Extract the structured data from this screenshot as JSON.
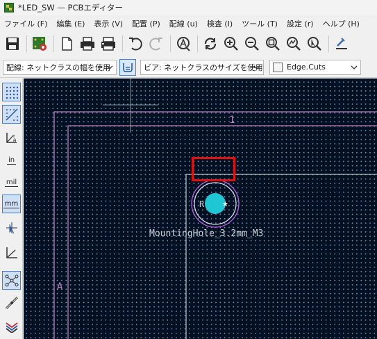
{
  "window": {
    "title": "*LED_SW — PCBエディター"
  },
  "menubar": {
    "items": [
      "ファイル (F)",
      "編集 (E)",
      "表示 (V)",
      "配置 (P)",
      "配線 (u)",
      "検査 (I)",
      "ツール (T)",
      "設定 (r)",
      "ヘルプ (H)"
    ]
  },
  "optionbar": {
    "track_width": "配線: ネットクラスの幅を使用",
    "via_size": "ビア: ネットクラスのサイズを使用",
    "layer": "Edge.Cuts"
  },
  "lefttoolbar": {
    "units_in": "in",
    "units_mil": "mil",
    "units_mm": "mm"
  },
  "canvas": {
    "sheet_zone_1": "1",
    "sheet_zone_a": "A",
    "footprint_name": "MountingHole_3.2mm_M3",
    "footprint_ref": "R",
    "colors": {
      "background": "#001023",
      "sheet_border": "#c080c0",
      "board_edge": "#e8e8e8",
      "pad": "#1fc6d4",
      "courtyard": "#c060e0",
      "highlight": "#e01010"
    }
  }
}
